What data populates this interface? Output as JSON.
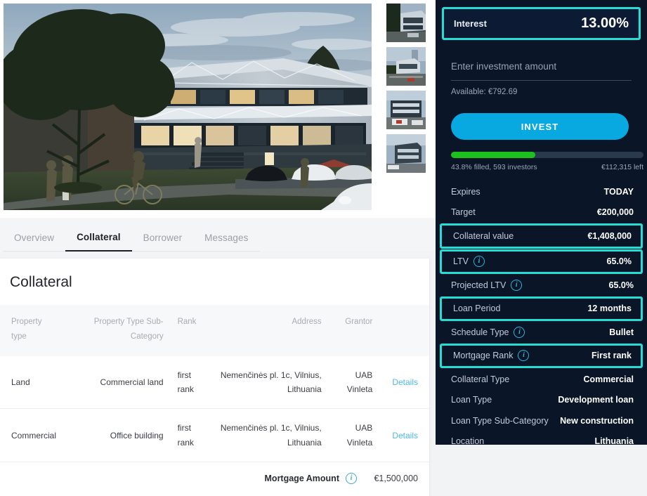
{
  "gallery": {
    "thumbnail_count": 4,
    "thumbnails": [
      "property-photo-1",
      "property-photo-2",
      "property-photo-3",
      "property-photo-4"
    ],
    "hero_alt": "architectural-render-office-building-dusk"
  },
  "tabs": [
    {
      "label": "Overview",
      "active": false
    },
    {
      "label": "Collateral",
      "active": true
    },
    {
      "label": "Borrower",
      "active": false
    },
    {
      "label": "Messages",
      "active": false
    }
  ],
  "collateral": {
    "title": "Collateral",
    "columns": [
      "Property type",
      "Property Type Sub-Category",
      "Rank",
      "Address",
      "Grantor",
      ""
    ],
    "columns_split": {
      "property_type": [
        "Property",
        "type"
      ],
      "property_sub": [
        "Property Type Sub-",
        "Category"
      ],
      "rank": "Rank",
      "address": "Address",
      "grantor": "Grantor"
    },
    "rows": [
      {
        "property_type": "Land",
        "property_sub": "Commercial land",
        "rank_line1": "first",
        "rank_line2": "rank",
        "address_line1": "Nemenčinės pl. 1c, Vilnius,",
        "address_line2": "Lithuania",
        "grantor_line1": "UAB",
        "grantor_line2": "Vinleta",
        "details_label": "Details"
      },
      {
        "property_type": "Commercial",
        "property_sub": "Office building",
        "rank_line1": "first",
        "rank_line2": "rank",
        "address_line1": "Nemenčinės pl. 1c, Vilnius,",
        "address_line2": "Lithuania",
        "grantor_line1": "UAB",
        "grantor_line2": "Vinleta",
        "details_label": "Details"
      }
    ],
    "footer": {
      "label": "Mortgage Amount",
      "info_icon": "info-icon",
      "value": "€1,500,000"
    }
  },
  "invest_panel": {
    "interest": {
      "label": "Interest",
      "value": "13.00%",
      "highlighted": true
    },
    "amount_input": {
      "placeholder": "Enter investment amount",
      "value": ""
    },
    "available_text": "Available: €792.69",
    "invest_button_label": "INVEST",
    "progress": {
      "percent": 43.8,
      "filled_text": "43.8% filled, 593 investors",
      "remaining_text": "€112,315 left"
    },
    "details": [
      {
        "label": "Expires",
        "value": "TODAY",
        "info": false,
        "highlighted": false
      },
      {
        "label": "Target",
        "value": "€200,000",
        "info": false,
        "highlighted": false
      },
      {
        "label": "Collateral value",
        "value": "€1,408,000",
        "info": false,
        "highlighted": true
      },
      {
        "label": "LTV",
        "value": "65.0%",
        "info": true,
        "highlighted": true
      },
      {
        "label": "Projected LTV",
        "value": "65.0%",
        "info": true,
        "highlighted": false
      },
      {
        "label": "Loan Period",
        "value": "12 months",
        "info": false,
        "highlighted": true
      },
      {
        "label": "Schedule Type",
        "value": "Bullet",
        "info": true,
        "highlighted": false
      },
      {
        "label": "Mortgage Rank",
        "value": "First rank",
        "info": true,
        "highlighted": true
      },
      {
        "label": "Collateral Type",
        "value": "Commercial",
        "info": false,
        "highlighted": false
      },
      {
        "label": "Loan Type",
        "value": "Development loan",
        "info": false,
        "highlighted": false
      },
      {
        "label": "Loan Type Sub-Category",
        "value": "New construction",
        "info": false,
        "highlighted": false
      },
      {
        "label": "Location",
        "value": "Lithuania",
        "info": false,
        "highlighted": false
      }
    ]
  },
  "colors": {
    "panel_bg": "#0a1528",
    "highlight": "#26ddd5",
    "invest_button": "#07a9e0",
    "progress_fill": "#1dc11d",
    "progress_track": "#2a3a4d",
    "link": "#4fb8e8",
    "info_icon": "#3aa8d8"
  }
}
